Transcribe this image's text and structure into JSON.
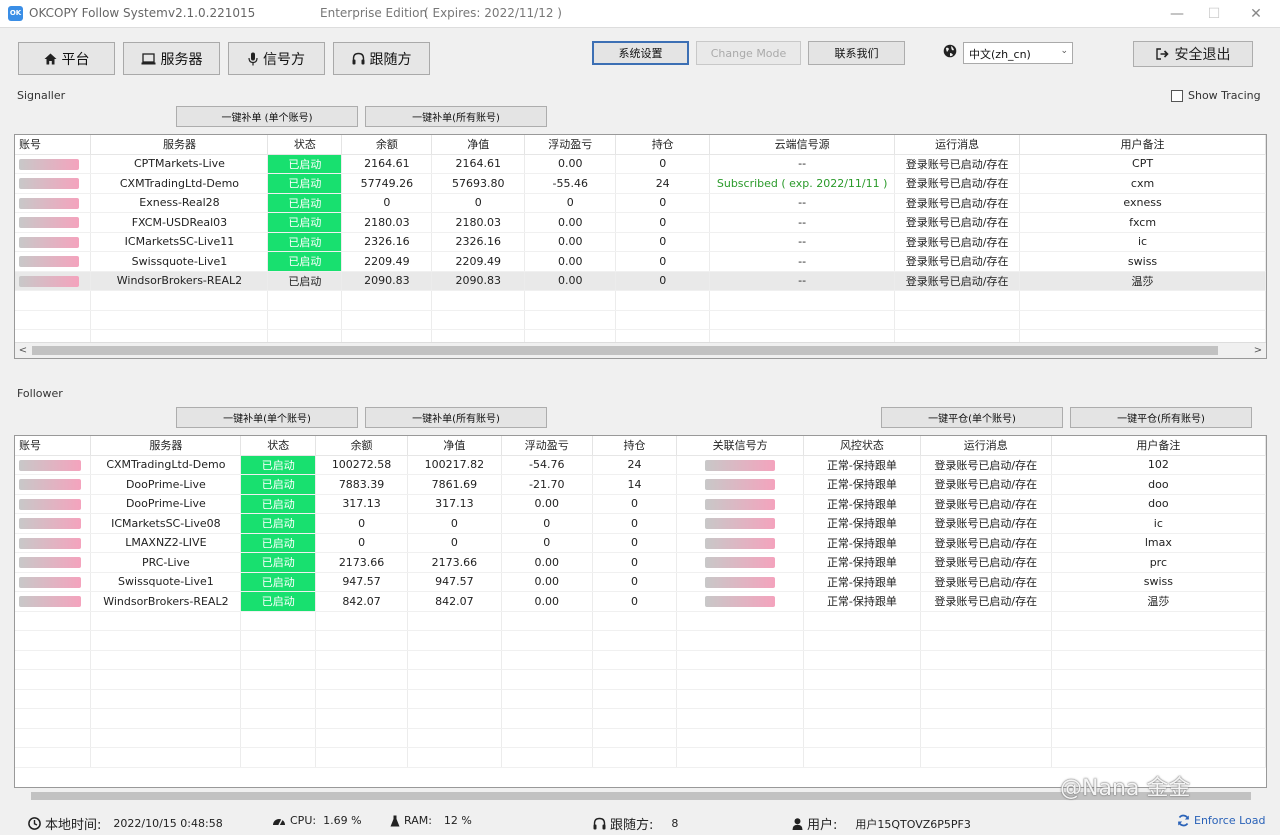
{
  "app": {
    "icon_text": "OK",
    "title": "OKCOPY Follow System",
    "version": "v2.1.0.221015",
    "edition": "Enterprise Edition",
    "expires": "( Expires: 2022/11/12 )"
  },
  "nav": [
    {
      "label": "平台",
      "icon": "home-icon"
    },
    {
      "label": "服务器",
      "icon": "laptop-icon"
    },
    {
      "label": "信号方",
      "icon": "microphone-icon"
    },
    {
      "label": "跟随方",
      "icon": "headphones-icon"
    }
  ],
  "toolbar": {
    "settings_label": "系统设置",
    "change_mode_label": "Change Mode",
    "contact_label": "联系我们",
    "language": "中文(zh_cn)",
    "logout_label": "安全退出"
  },
  "signaller": {
    "section_label": "Signaller",
    "show_tracing_label": "Show Tracing",
    "show_tracing_checked": false,
    "fill_single_label": "一键补单 (单个账号)",
    "fill_all_label": "一键补单(所有账号)",
    "columns": [
      "账号",
      "服务器",
      "状态",
      "余额",
      "净值",
      "浮动盈亏",
      "持仓",
      "云端信号源",
      "运行消息",
      "用户备注"
    ],
    "rows": [
      {
        "account_redacted": true,
        "server": "CPTMarkets-Live",
        "status": "已启动",
        "status_on": true,
        "balance": "2164.61",
        "equity": "2164.61",
        "float_pl": "0.00",
        "positions": "0",
        "cloud_signal": "--",
        "message": "登录账号已启动/存在",
        "note": "CPT"
      },
      {
        "account_redacted": true,
        "server": "CXMTradingLtd-Demo",
        "status": "已启动",
        "status_on": true,
        "balance": "57749.26",
        "equity": "57693.80",
        "float_pl": "-55.46",
        "positions": "24",
        "cloud_signal": "Subscribed ( exp. 2022/11/11 )",
        "message": "登录账号已启动/存在",
        "note": "cxm"
      },
      {
        "account_redacted": true,
        "server": "Exness-Real28",
        "status": "已启动",
        "status_on": true,
        "balance": "0",
        "equity": "0",
        "float_pl": "0",
        "positions": "0",
        "cloud_signal": "--",
        "message": "登录账号已启动/存在",
        "note": "exness"
      },
      {
        "account_redacted": true,
        "server": "FXCM-USDReal03",
        "status": "已启动",
        "status_on": true,
        "balance": "2180.03",
        "equity": "2180.03",
        "float_pl": "0.00",
        "positions": "0",
        "cloud_signal": "--",
        "message": "登录账号已启动/存在",
        "note": "fxcm"
      },
      {
        "account_redacted": true,
        "server": "ICMarketsSC-Live11",
        "status": "已启动",
        "status_on": true,
        "balance": "2326.16",
        "equity": "2326.16",
        "float_pl": "0.00",
        "positions": "0",
        "cloud_signal": "--",
        "message": "登录账号已启动/存在",
        "note": "ic"
      },
      {
        "account_redacted": true,
        "server": "Swissquote-Live1",
        "status": "已启动",
        "status_on": true,
        "balance": "2209.49",
        "equity": "2209.49",
        "float_pl": "0.00",
        "positions": "0",
        "cloud_signal": "--",
        "message": "登录账号已启动/存在",
        "note": "swiss"
      },
      {
        "account_redacted": true,
        "server": "WindsorBrokers-REAL2",
        "status": "已启动",
        "status_on": false,
        "balance": "2090.83",
        "equity": "2090.83",
        "float_pl": "0.00",
        "positions": "0",
        "cloud_signal": "--",
        "message": "登录账号已启动/存在",
        "note": "温莎"
      }
    ]
  },
  "follower": {
    "section_label": "Follower",
    "fill_single_label": "一键补单(单个账号)",
    "fill_all_label": "一键补单(所有账号)",
    "close_single_label": "一键平仓(单个账号)",
    "close_all_label": "一键平仓(所有账号)",
    "columns": [
      "账号",
      "服务器",
      "状态",
      "余额",
      "净值",
      "浮动盈亏",
      "持仓",
      "关联信号方",
      "风控状态",
      "运行消息",
      "用户备注"
    ],
    "rows": [
      {
        "account_redacted": true,
        "server": "CXMTradingLtd-Demo",
        "status": "已启动",
        "balance": "100272.58",
        "equity": "100217.82",
        "float_pl": "-54.76",
        "positions": "24",
        "signal_redacted": true,
        "risk": "正常-保持跟单",
        "message": "登录账号已启动/存在",
        "note": "102"
      },
      {
        "account_redacted": true,
        "server": "DooPrime-Live",
        "status": "已启动",
        "balance": "7883.39",
        "equity": "7861.69",
        "float_pl": "-21.70",
        "positions": "14",
        "signal_redacted": true,
        "risk": "正常-保持跟单",
        "message": "登录账号已启动/存在",
        "note": "doo"
      },
      {
        "account_redacted": true,
        "server": "DooPrime-Live",
        "status": "已启动",
        "balance": "317.13",
        "equity": "317.13",
        "float_pl": "0.00",
        "positions": "0",
        "signal_redacted": true,
        "risk": "正常-保持跟单",
        "message": "登录账号已启动/存在",
        "note": "doo"
      },
      {
        "account_redacted": true,
        "server": "ICMarketsSC-Live08",
        "status": "已启动",
        "balance": "0",
        "equity": "0",
        "float_pl": "0",
        "positions": "0",
        "signal_redacted": true,
        "risk": "正常-保持跟单",
        "message": "登录账号已启动/存在",
        "note": "ic"
      },
      {
        "account_redacted": true,
        "server": "LMAXNZ2-LIVE",
        "status": "已启动",
        "balance": "0",
        "equity": "0",
        "float_pl": "0",
        "positions": "0",
        "signal_redacted": true,
        "risk": "正常-保持跟单",
        "message": "登录账号已启动/存在",
        "note": "lmax"
      },
      {
        "account_redacted": true,
        "server": "PRC-Live",
        "status": "已启动",
        "balance": "2173.66",
        "equity": "2173.66",
        "float_pl": "0.00",
        "positions": "0",
        "signal_redacted": true,
        "risk": "正常-保持跟单",
        "message": "登录账号已启动/存在",
        "note": "prc"
      },
      {
        "account_redacted": true,
        "server": "Swissquote-Live1",
        "status": "已启动",
        "balance": "947.57",
        "equity": "947.57",
        "float_pl": "0.00",
        "positions": "0",
        "signal_redacted": true,
        "risk": "正常-保持跟单",
        "message": "登录账号已启动/存在",
        "note": "swiss"
      },
      {
        "account_redacted": true,
        "server": "WindsorBrokers-REAL2",
        "status": "已启动",
        "balance": "842.07",
        "equity": "842.07",
        "float_pl": "0.00",
        "positions": "0",
        "signal_redacted": true,
        "risk": "正常-保持跟单",
        "message": "登录账号已启动/存在",
        "note": "温莎"
      }
    ]
  },
  "status_bar": {
    "time_label": "本地时间:",
    "time_value": "2022/10/15 0:48:58",
    "cpu_label": "CPU:",
    "cpu_value": "1.69 %",
    "ram_label": "RAM:",
    "ram_value": "12 %",
    "followers_label": "跟随方:",
    "followers_value": "8",
    "user_label": "用户:",
    "user_value": "用户15QTOVZ6P5PF3",
    "enforce_label": "Enforce Load"
  },
  "watermark": "@Nana 金金",
  "colors": {
    "status_on": "#18e06f",
    "subscribed_text": "#2a9a2a",
    "accent_blue": "#3c6fb4",
    "redaction_pink": "#f4a3bd"
  }
}
